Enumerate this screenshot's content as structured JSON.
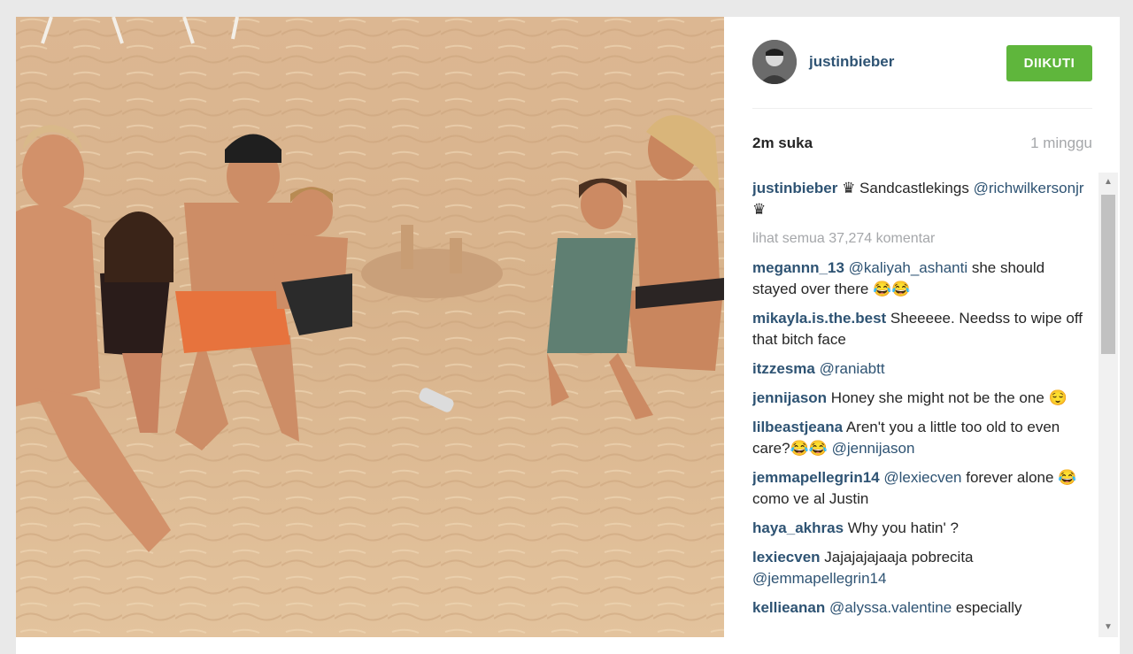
{
  "post": {
    "username": "justinbieber",
    "follow_label": "DIIKUTI",
    "likes": "2m suka",
    "time": "1 minggu"
  },
  "caption": {
    "user": "justinbieber",
    "text_pre": " ♛ Sandcastlekings ",
    "mention": "@richwilkersonjr",
    "text_post": " ♛"
  },
  "view_all": "lihat semua 37,274 komentar",
  "comments": [
    {
      "user": "megannn_13",
      "mention": "@kaliyah_ashanti",
      "text": " she should stayed over there 😂😂"
    },
    {
      "user": "mikayla.is.the.best",
      "mention": "",
      "text": " Sheeeee. Needss to wipe off that bitch face"
    },
    {
      "user": "itzzesma",
      "mention": "@raniabtt",
      "text": ""
    },
    {
      "user": "jennijason",
      "mention": "",
      "text": " Honey she might not be the one 😌"
    },
    {
      "user": "lilbeastjeana",
      "mention": "",
      "text": " Aren't you a little too old to even care?😂😂 ",
      "mention2": "@jennijason"
    },
    {
      "user": "jemmapellegrin14",
      "mention": "@lexiecven",
      "text": " forever alone 😂 como ve al Justin"
    },
    {
      "user": "haya_akhras",
      "mention": "",
      "text": " Why you hatin' ?"
    },
    {
      "user": "lexiecven",
      "mention": "",
      "text": " Jajajajajaaja pobrecita ",
      "mention2": "@jemmapellegrin14"
    },
    {
      "user": "kellieanan",
      "mention": "@alyssa.valentine",
      "text": " especially"
    }
  ],
  "icons": {
    "avatar": "user-avatar",
    "scroll_up": "scroll-up-arrow",
    "scroll_down": "scroll-down-arrow"
  },
  "colors": {
    "follow": "#5fb63c",
    "username": "#2e5373",
    "muted": "#a5a7aa"
  }
}
